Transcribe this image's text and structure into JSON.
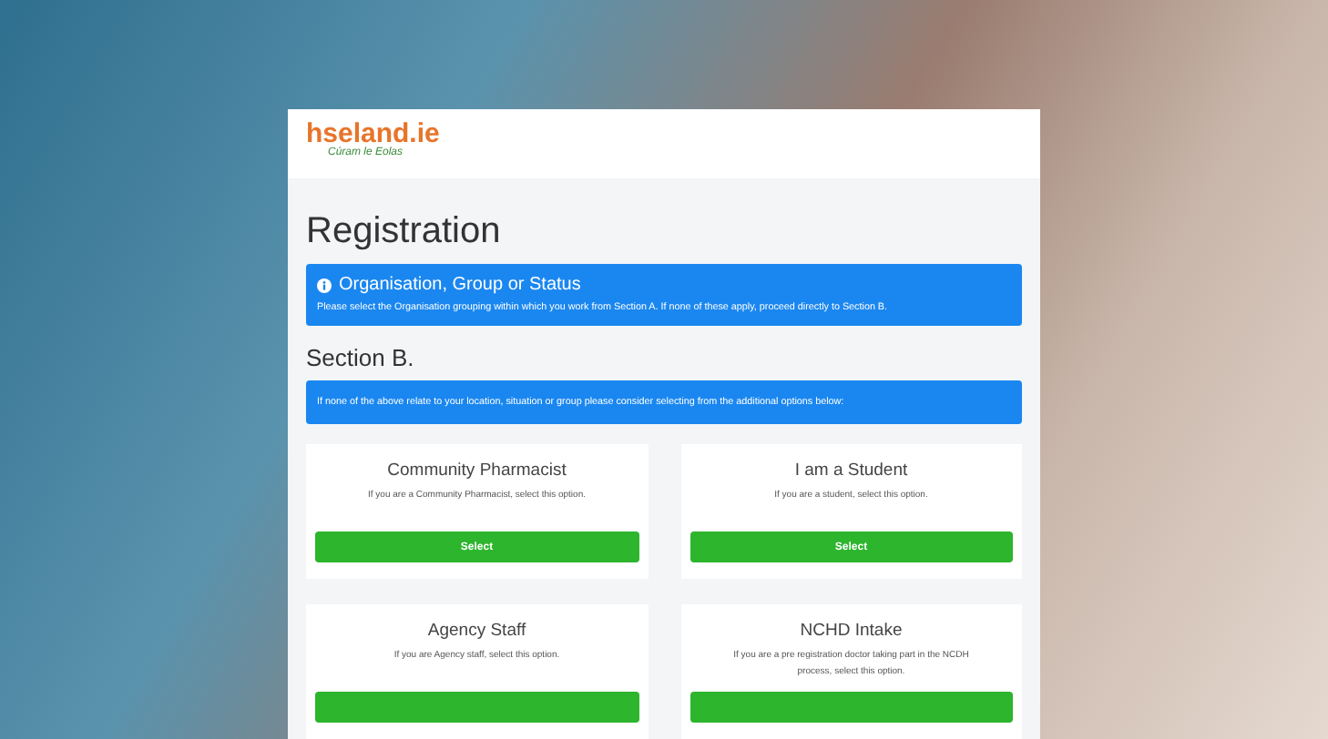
{
  "logo": {
    "name": "hseland.ie",
    "tagline": "Cúram le Eolas"
  },
  "title": "Registration",
  "info": {
    "heading": "Organisation, Group or Status",
    "text": "Please select the Organisation grouping within which you work from Section A. If none of these apply, proceed directly to Section B."
  },
  "section_title": "Section B.",
  "section_note": "If none of the above relate to your location, situation or group please consider selecting from the additional options below:",
  "cards": [
    {
      "title": "Community Pharmacist",
      "text": "If you are a Community Pharmacist, select this option.",
      "button": "Select"
    },
    {
      "title": "I am a Student",
      "text": "If you are a student, select this option.",
      "button": "Select"
    },
    {
      "title": "Agency Staff",
      "text": "If you are Agency staff, select this option."
    },
    {
      "title": "NCHD Intake",
      "text": "If you are a pre registration doctor taking part in the NCDH process, select this option."
    }
  ]
}
